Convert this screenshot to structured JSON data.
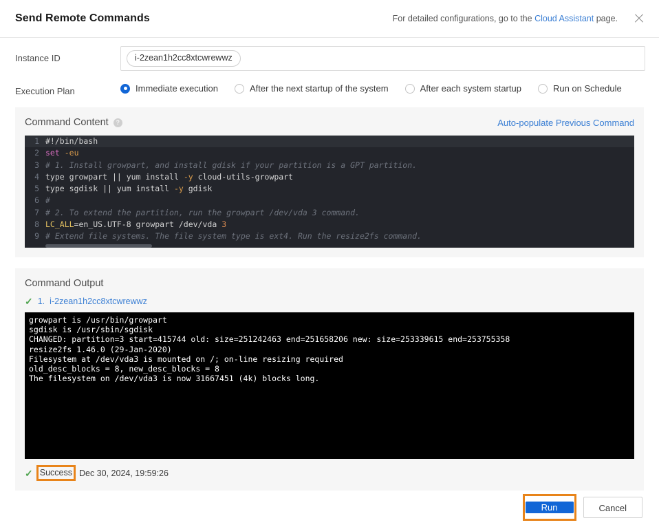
{
  "header": {
    "title": "Send Remote Commands",
    "note_prefix": "For detailed configurations, go to the ",
    "note_link": "Cloud Assistant",
    "note_suffix": " page.",
    "close_icon": "close-icon"
  },
  "form": {
    "instance_id_label": "Instance ID",
    "instance_id_value": "i-2zean1h2cc8xtcwrewwz",
    "execution_plan_label": "Execution Plan",
    "execution_plan_options": [
      {
        "label": "Immediate execution",
        "checked": true
      },
      {
        "label": "After the next startup of the system",
        "checked": false
      },
      {
        "label": "After each system startup",
        "checked": false
      },
      {
        "label": "Run on Schedule",
        "checked": false
      }
    ]
  },
  "command_content": {
    "title": "Command Content",
    "help_icon": "?",
    "auto_populate_link": "Auto-populate Previous Command",
    "lines": [
      {
        "no": "1",
        "active": true,
        "segments": [
          {
            "t": "#!/bin/bash",
            "c": "ctext"
          }
        ]
      },
      {
        "no": "2",
        "active": false,
        "segments": [
          {
            "t": "set",
            "c": "tok-kw"
          },
          {
            "t": " ",
            "c": "ctext"
          },
          {
            "t": "-eu",
            "c": "tok-flag"
          }
        ]
      },
      {
        "no": "3",
        "active": false,
        "segments": [
          {
            "t": "# 1. Install growpart, and install gdisk if your partition is a GPT partition.",
            "c": "tok-com"
          }
        ]
      },
      {
        "no": "4",
        "active": false,
        "segments": [
          {
            "t": "type growpart ",
            "c": "ctext"
          },
          {
            "t": "||",
            "c": "tok-op"
          },
          {
            "t": " yum install ",
            "c": "ctext"
          },
          {
            "t": "-y",
            "c": "tok-flag"
          },
          {
            "t": " cloud-utils-growpart",
            "c": "ctext"
          }
        ]
      },
      {
        "no": "5",
        "active": false,
        "segments": [
          {
            "t": "type sgdisk ",
            "c": "ctext"
          },
          {
            "t": "||",
            "c": "tok-op"
          },
          {
            "t": " yum install ",
            "c": "ctext"
          },
          {
            "t": "-y",
            "c": "tok-flag"
          },
          {
            "t": " gdisk",
            "c": "ctext"
          }
        ]
      },
      {
        "no": "6",
        "active": false,
        "segments": [
          {
            "t": "#",
            "c": "tok-com"
          }
        ]
      },
      {
        "no": "7",
        "active": false,
        "segments": [
          {
            "t": "# 2. To extend the partition, run the growpart /dev/vda 3 command.",
            "c": "tok-com"
          }
        ]
      },
      {
        "no": "8",
        "active": false,
        "segments": [
          {
            "t": "LC_ALL",
            "c": "tok-var"
          },
          {
            "t": "=en_US.UTF-8 growpart /dev/vda ",
            "c": "ctext"
          },
          {
            "t": "3",
            "c": "tok-num"
          }
        ]
      },
      {
        "no": "9",
        "active": false,
        "segments": [
          {
            "t": "# Extend file systems. The file system type is ext4. Run the resize2fs command.",
            "c": "tok-com"
          }
        ]
      }
    ]
  },
  "command_output": {
    "title": "Command Output",
    "instance_index": "1.",
    "instance_link": "i-2zean1h2cc8xtcwrewwz",
    "status_check_icon": "check-icon",
    "terminal_lines": [
      "growpart is /usr/bin/growpart",
      "sgdisk is /usr/sbin/sgdisk",
      "CHANGED: partition=3 start=415744 old: size=251242463 end=251658206 new: size=253339615 end=253755358",
      "resize2fs 1.46.0 (29-Jan-2020)",
      "Filesystem at /dev/vda3 is mounted on /; on-line resizing required",
      "old_desc_blocks = 8, new_desc_blocks = 8",
      "The filesystem on /dev/vda3 is now 31667451 (4k) blocks long."
    ],
    "status_label": "Success",
    "status_time": "Dec 30, 2024, 19:59:26"
  },
  "footer": {
    "run_label": "Run",
    "cancel_label": "Cancel"
  },
  "colors": {
    "accent_blue": "#1266d6",
    "link_blue": "#3b7fd4",
    "highlight_orange": "#e8841a",
    "success_green": "#52a552",
    "editor_bg": "#23252b",
    "terminal_bg": "#000000",
    "panel_bg": "#f6f6f6"
  }
}
